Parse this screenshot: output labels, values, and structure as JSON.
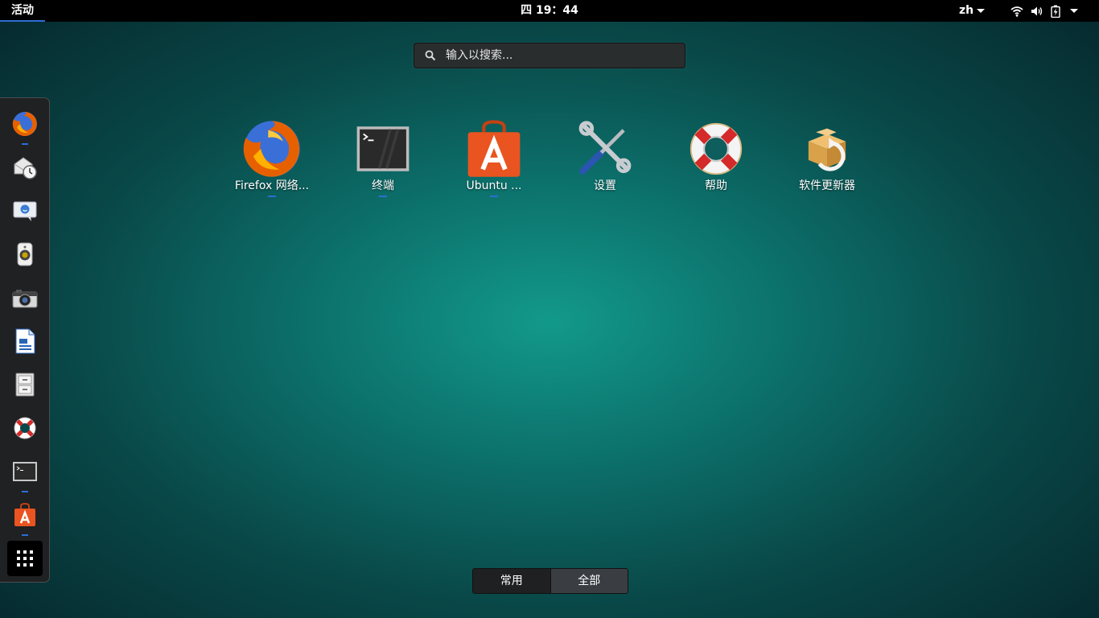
{
  "topbar": {
    "activities": "活动",
    "clock": "四 19：44",
    "language": "zh"
  },
  "search": {
    "placeholder": "输入以搜索..."
  },
  "dash": {
    "items": [
      {
        "icon": "firefox-icon",
        "running": true
      },
      {
        "icon": "mail-clock-icon",
        "running": false
      },
      {
        "icon": "chat-icon",
        "running": false
      },
      {
        "icon": "speaker-icon",
        "running": false
      },
      {
        "icon": "camera-icon",
        "running": false
      },
      {
        "icon": "writer-document-icon",
        "running": false
      },
      {
        "icon": "file-cabinet-icon",
        "running": false
      },
      {
        "icon": "help-lifebuoy-icon",
        "running": false
      },
      {
        "icon": "terminal-icon",
        "running": true
      },
      {
        "icon": "software-center-icon",
        "running": true
      }
    ],
    "show_apps_icon": "grid-icon"
  },
  "apps": [
    {
      "label": "Firefox 网络...",
      "icon": "firefox-icon",
      "running": true
    },
    {
      "label": "终端",
      "icon": "terminal-icon",
      "running": true
    },
    {
      "label": "Ubuntu ...",
      "icon": "software-center-icon",
      "running": true
    },
    {
      "label": "设置",
      "icon": "settings-tools-icon",
      "running": false
    },
    {
      "label": "帮助",
      "icon": "help-lifebuoy-icon",
      "running": false
    },
    {
      "label": "软件更新器",
      "icon": "software-updater-icon",
      "running": false
    }
  ],
  "switcher": {
    "frequent": "常用",
    "all": "全部"
  },
  "colors": {
    "accent": "#2c6ed5",
    "topbar": "#000000",
    "firefox": "#e66000",
    "software_center": "#e95420"
  }
}
